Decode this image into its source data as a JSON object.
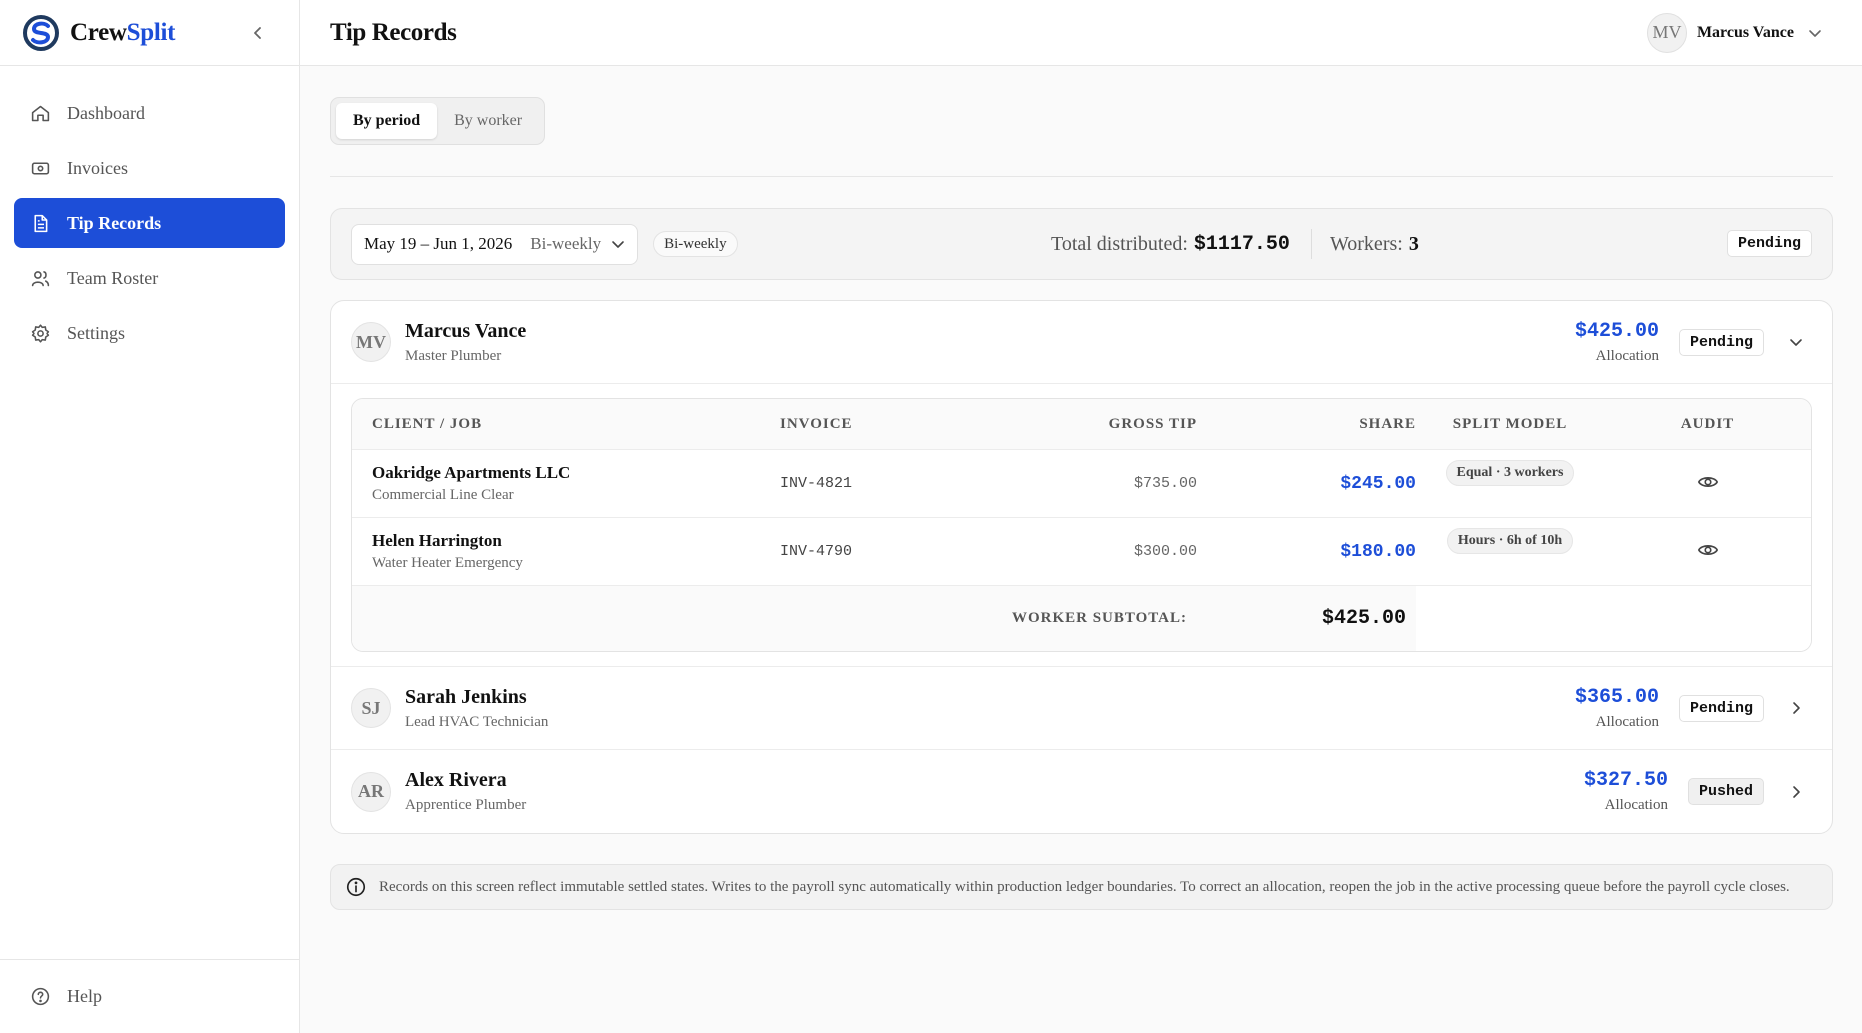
{
  "brand": {
    "name_part1": "Crew",
    "name_part2": "Split",
    "accent": "#1d4ed8"
  },
  "sidebar": {
    "items": [
      {
        "label": "Dashboard",
        "icon": "home-icon"
      },
      {
        "label": "Invoices",
        "icon": "banknote-icon"
      },
      {
        "label": "Tip Records",
        "icon": "file-text-icon",
        "active": true
      },
      {
        "label": "Team Roster",
        "icon": "users-icon"
      },
      {
        "label": "Settings",
        "icon": "gear-icon"
      }
    ],
    "help_label": "Help"
  },
  "header": {
    "title": "Tip Records",
    "user": {
      "initials": "MV",
      "name": "Marcus Vance"
    }
  },
  "view_toggle": {
    "options": [
      "By period",
      "By worker"
    ],
    "selected": "By period"
  },
  "period": {
    "range": "May 19 – Jun 1, 2026",
    "frequency": "Bi-weekly",
    "chip": "Bi-weekly",
    "total_label": "Total distributed:",
    "total_value": "$1117.50",
    "workers_label": "Workers:",
    "workers_value": "3",
    "status": "Pending"
  },
  "workers": [
    {
      "initials": "MV",
      "name": "Marcus Vance",
      "role": "Master Plumber",
      "amount": "$425.00",
      "amount_label": "Allocation",
      "status": "Pending",
      "expanded": true,
      "table": {
        "headers": [
          "CLIENT / JOB",
          "INVOICE",
          "GROSS TIP",
          "SHARE",
          "SPLIT MODEL",
          "AUDIT"
        ],
        "rows": [
          {
            "client": "Oakridge Apartments LLC",
            "job": "Commercial Line Clear",
            "invoice": "INV-4821",
            "gross": "$735.00",
            "share": "$245.00",
            "split": "Equal · 3 workers"
          },
          {
            "client": "Helen Harrington",
            "job": "Water Heater Emergency",
            "invoice": "INV-4790",
            "gross": "$300.00",
            "share": "$180.00",
            "split": "Hours · 6h of 10h"
          }
        ],
        "subtotal_label": "WORKER SUBTOTAL:",
        "subtotal_value": "$425.00"
      }
    },
    {
      "initials": "SJ",
      "name": "Sarah Jenkins",
      "role": "Lead HVAC Technician",
      "amount": "$365.00",
      "amount_label": "Allocation",
      "status": "Pending",
      "expanded": false
    },
    {
      "initials": "AR",
      "name": "Alex Rivera",
      "role": "Apprentice Plumber",
      "amount": "$327.50",
      "amount_label": "Allocation",
      "status": "Pushed",
      "expanded": false
    }
  ],
  "notice": "Records on this screen reflect immutable settled states. Writes to the payroll sync automatically within production ledger boundaries. To correct an allocation, reopen the job in the active processing queue before the payroll cycle closes."
}
